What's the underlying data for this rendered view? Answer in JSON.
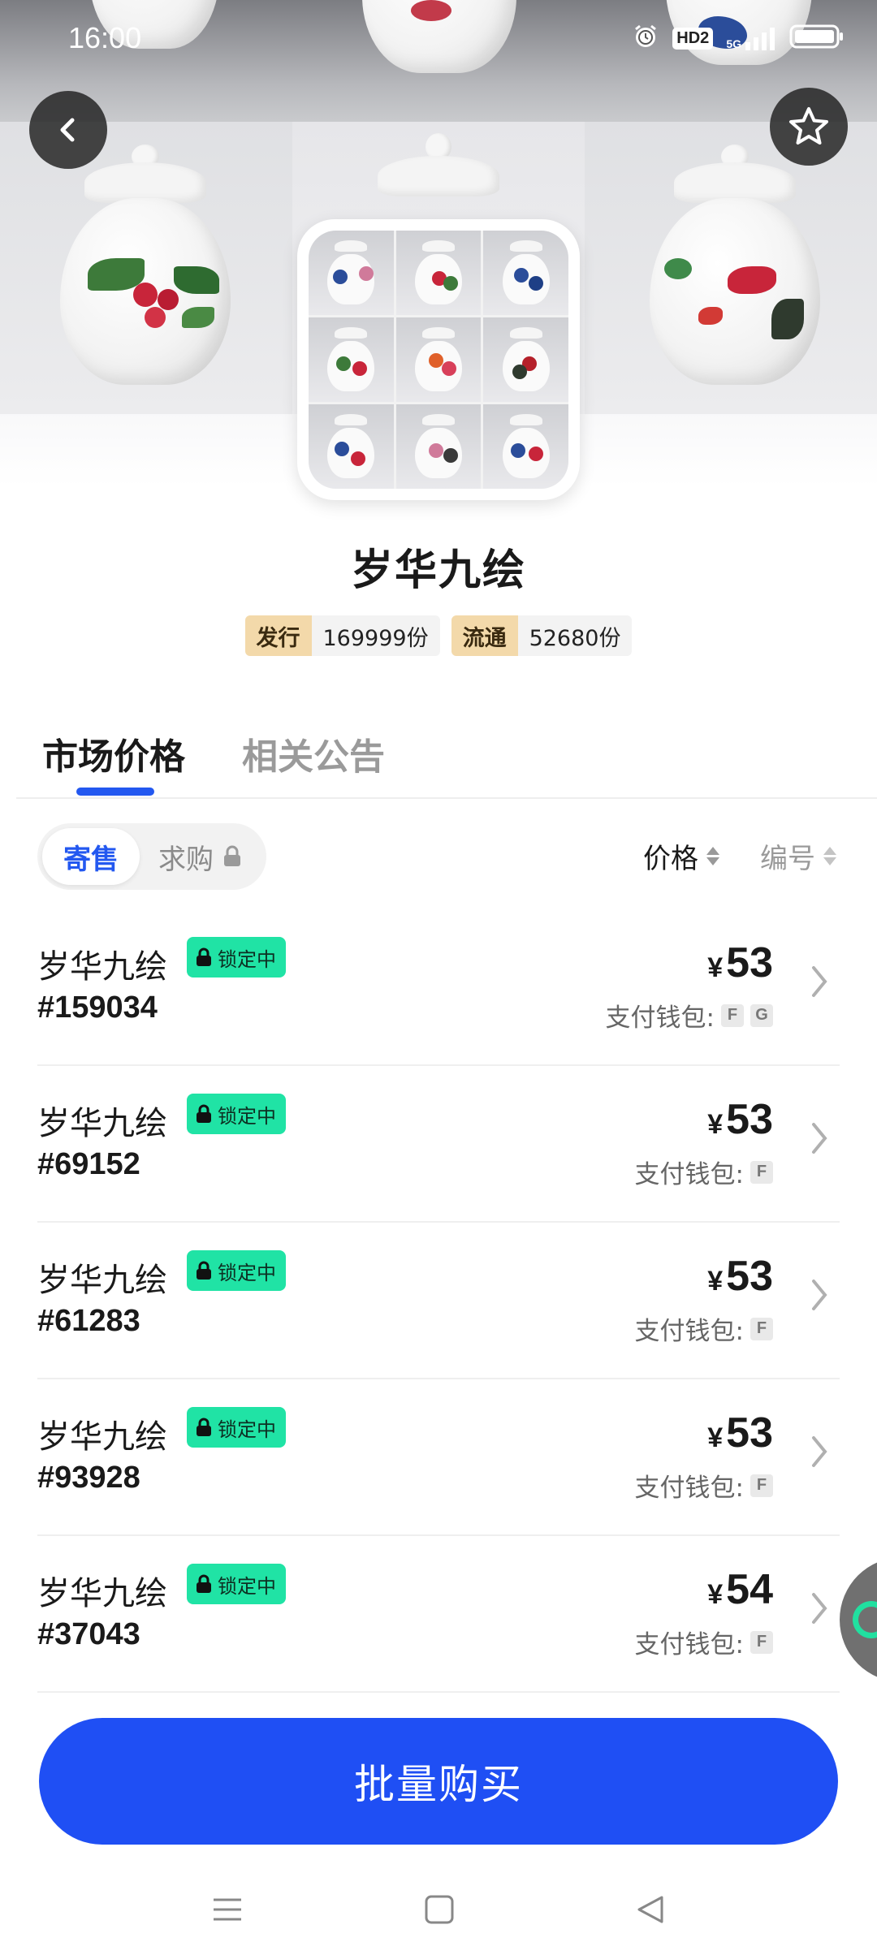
{
  "status_bar": {
    "time": "16:00",
    "hd_label": "HD2",
    "network_label": "5G"
  },
  "header": {
    "back_icon": "chevron-left-icon",
    "favorite_icon": "star-outline-icon"
  },
  "collection": {
    "title": "岁华九绘",
    "issue_label": "发行",
    "issue_value": "169999份",
    "circulation_label": "流通",
    "circulation_value": "52680份"
  },
  "tabs": [
    {
      "label": "市场价格",
      "active": true
    },
    {
      "label": "相关公告",
      "active": false
    }
  ],
  "segment": {
    "sell_label": "寄售",
    "buy_label": "求购"
  },
  "sort": {
    "price_label": "价格",
    "number_label": "编号"
  },
  "listings": [
    {
      "name": "岁华九绘",
      "badge": "锁定中",
      "serial": "#159034",
      "currency": "¥",
      "price": "53",
      "wallet_label": "支付钱包:",
      "wallets": [
        "F",
        "G"
      ]
    },
    {
      "name": "岁华九绘",
      "badge": "锁定中",
      "serial": "#69152",
      "currency": "¥",
      "price": "53",
      "wallet_label": "支付钱包:",
      "wallets": [
        "F"
      ]
    },
    {
      "name": "岁华九绘",
      "badge": "锁定中",
      "serial": "#61283",
      "currency": "¥",
      "price": "53",
      "wallet_label": "支付钱包:",
      "wallets": [
        "F"
      ]
    },
    {
      "name": "岁华九绘",
      "badge": "锁定中",
      "serial": "#93928",
      "currency": "¥",
      "price": "53",
      "wallet_label": "支付钱包:",
      "wallets": [
        "F"
      ]
    },
    {
      "name": "岁华九绘",
      "badge": "锁定中",
      "serial": "#37043",
      "currency": "¥",
      "price": "54",
      "wallet_label": "支付钱包:",
      "wallets": [
        "F"
      ]
    }
  ],
  "bulk_buy_label": "批量购买",
  "colors": {
    "accent": "#1f4ff4",
    "lock_badge": "#20e3a5",
    "tag_bg": "#f3d9aa"
  }
}
